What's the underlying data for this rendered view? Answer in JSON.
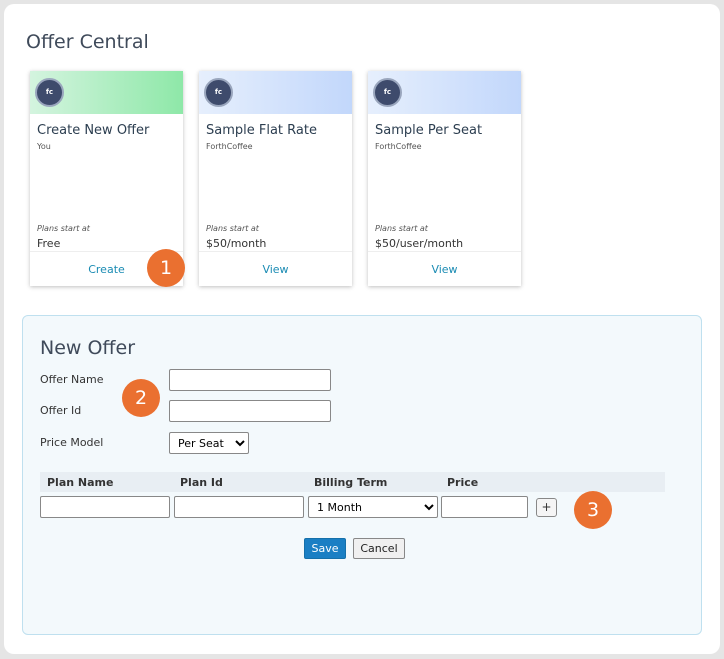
{
  "page": {
    "title": "Offer Central"
  },
  "cards": [
    {
      "title": "Create New Offer",
      "owner": "You",
      "plans_label": "Plans start at",
      "price": "Free",
      "action": "Create",
      "logo": "fc"
    },
    {
      "title": "Sample Flat Rate",
      "owner": "ForthCoffee",
      "plans_label": "Plans start at",
      "price": "$50/month",
      "action": "View",
      "logo": "fc"
    },
    {
      "title": "Sample Per Seat",
      "owner": "ForthCoffee",
      "plans_label": "Plans start at",
      "price": "$50/user/month",
      "action": "View",
      "logo": "fc"
    }
  ],
  "callouts": [
    "1",
    "2",
    "3"
  ],
  "form": {
    "title": "New Offer",
    "offer_name_label": "Offer Name",
    "offer_name_value": "",
    "offer_id_label": "Offer Id",
    "offer_id_value": "",
    "price_model_label": "Price Model",
    "price_model_value": "Per Seat",
    "table": {
      "headers": [
        "Plan Name",
        "Plan Id",
        "Billing Term",
        "Price"
      ],
      "row": {
        "plan_name": "",
        "plan_id": "",
        "billing_term": "1 Month",
        "price": ""
      },
      "add_label": "+"
    },
    "save_label": "Save",
    "cancel_label": "Cancel"
  }
}
